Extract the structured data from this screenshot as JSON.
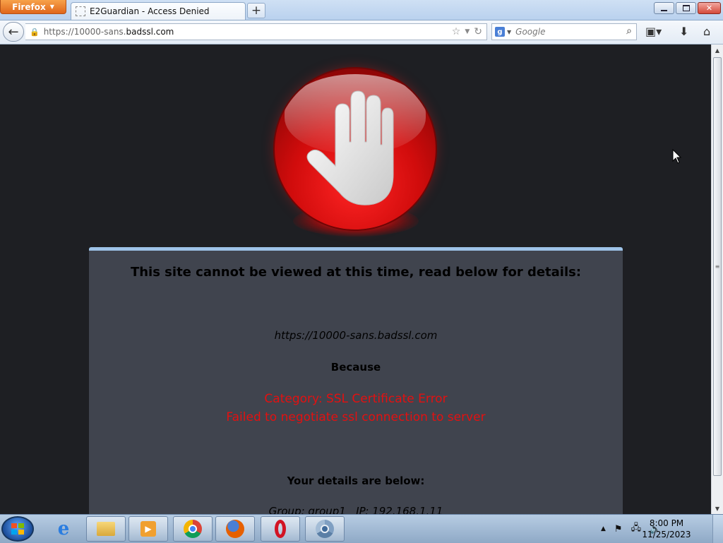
{
  "browser": {
    "menu_button_label": "Firefox",
    "tab_title": "E2Guardian - Access Denied",
    "new_tab_symbol": "+",
    "url_prefix": "https://10000-sans.",
    "url_host": "badssl.com",
    "search_placeholder": "Google",
    "search_engine_icon": "g-icon",
    "window_controls": {
      "minimize": "minimize-icon",
      "maximize": "restore-icon",
      "close": "close-icon"
    }
  },
  "block_page": {
    "headline": "This site cannot be viewed at this time, read below for details:",
    "blocked_url": "https://10000-sans.badssl.com",
    "because_label": "Because",
    "reason_category": "Category: SSL Certificate Error",
    "reason_detail": "Failed to negotiate ssl connection to server",
    "details_heading": "Your details are below:",
    "details_line": "Group: group1   IP: 192.168.1.11",
    "stop_icon": "stop-hand-icon",
    "reason_color": "#e41010",
    "panel_accent_color": "#9ec3e8"
  },
  "taskbar": {
    "apps": [
      "internet-explorer-icon",
      "file-explorer-icon",
      "media-player-icon",
      "chrome-icon",
      "firefox-icon",
      "opera-icon",
      "chromium-icon"
    ],
    "clock_time": "8:00 PM",
    "clock_date": "11/25/2023"
  }
}
